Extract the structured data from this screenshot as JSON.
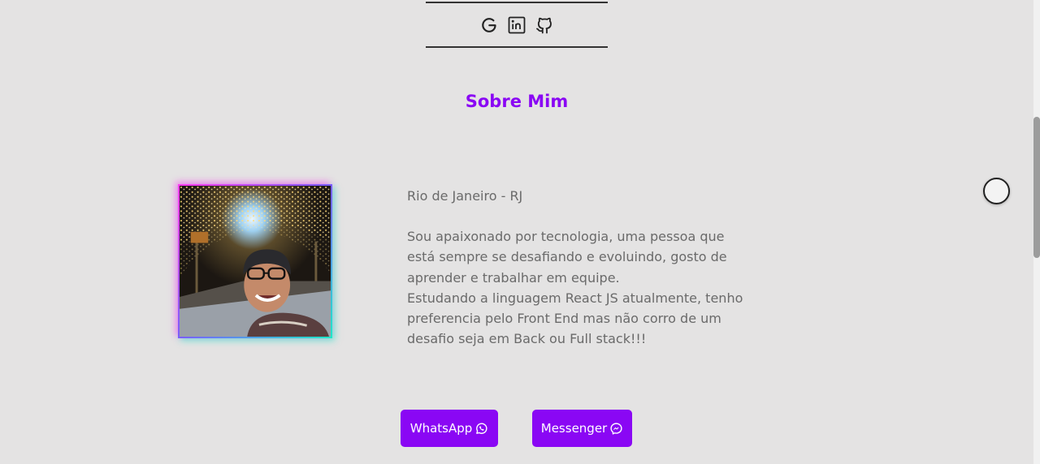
{
  "social": {
    "items": [
      {
        "icon": "google-icon"
      },
      {
        "icon": "linkedin-icon"
      },
      {
        "icon": "github-icon"
      }
    ]
  },
  "about": {
    "title": "Sobre Mim",
    "location": "Rio de Janeiro - RJ",
    "paragraph_lines": [
      "Sou apaixonado por tecnologia, uma pessoa que",
      "está sempre se desafiando e evoluindo, gosto de",
      "aprender e trabalhar em equipe.",
      "Estudando a linguagem React JS atualmente, tenho",
      "preferencia pelo Front End mas não corro de um",
      "desafio seja em Back ou Full stack!!!"
    ]
  },
  "buttons": {
    "whatsapp": {
      "label": "WhatsApp",
      "icon": "whatsapp-icon"
    },
    "messenger": {
      "label": "Messenger",
      "icon": "messenger-icon"
    }
  },
  "colors": {
    "accent": "#8a07f4",
    "background": "#e4e3e3",
    "text": "#6a6a6a"
  }
}
